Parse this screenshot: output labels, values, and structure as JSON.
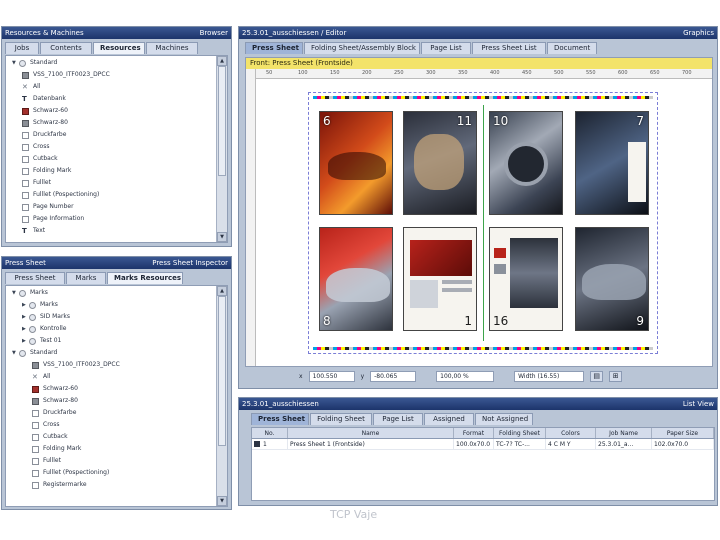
{
  "resources_panel": {
    "title": "Resources & Machines",
    "title_right": "Browser",
    "tabs": [
      "Jobs",
      "Contents",
      "Resources",
      "Machines"
    ],
    "active_tab": "Resources",
    "tree": [
      {
        "label": "Standard",
        "icon": "folder-icon",
        "expander": "minus"
      },
      {
        "label": "VSS_7100_ITF0023_DPCC",
        "icon": "color-swatch-icon"
      },
      {
        "label": "All",
        "icon": "cross-icon"
      },
      {
        "label": "Datenbank",
        "icon": "text-icon"
      },
      {
        "label": "Schwarz-60",
        "icon": "swatch-red-icon"
      },
      {
        "label": "Schwarz-80",
        "icon": "swatch-gray-icon"
      },
      {
        "label": "Druckfarbe",
        "icon": "page-icon"
      },
      {
        "label": "Cross",
        "icon": "page-icon"
      },
      {
        "label": "Cutback",
        "icon": "page-icon"
      },
      {
        "label": "Folding Mark",
        "icon": "page-icon"
      },
      {
        "label": "Fulllet",
        "icon": "page-icon"
      },
      {
        "label": "Fulllet (Pospectioning)",
        "icon": "page-icon"
      },
      {
        "label": "Page Number",
        "icon": "page-icon"
      },
      {
        "label": "Page Information",
        "icon": "page-icon"
      },
      {
        "label": "Text",
        "icon": "text-icon"
      }
    ]
  },
  "marks_panel": {
    "title": "Press Sheet",
    "title_right": "Press Sheet Inspector",
    "tabs": [
      "Press Sheet",
      "Marks",
      "Marks Resources"
    ],
    "active_tab": "Marks Resources",
    "tree": [
      {
        "label": "Marks",
        "icon": "folder-icon",
        "expander": "minus"
      },
      {
        "label": "Marks",
        "icon": "folder-icon",
        "expander": "plus",
        "indent": 1
      },
      {
        "label": "SID Marks",
        "icon": "folder-icon",
        "expander": "plus",
        "indent": 1
      },
      {
        "label": "Kontrolle",
        "icon": "folder-icon",
        "expander": "plus",
        "indent": 1
      },
      {
        "label": "Test 01",
        "icon": "folder-icon",
        "expander": "plus",
        "indent": 1
      },
      {
        "label": "Standard",
        "icon": "folder-icon",
        "expander": "minus"
      },
      {
        "label": "VSS_7100_ITF0023_DPCC",
        "icon": "color-swatch-icon",
        "indent": 1
      },
      {
        "label": "All",
        "icon": "cross-icon",
        "indent": 1
      },
      {
        "label": "Schwarz-60",
        "icon": "swatch-red-icon",
        "indent": 1
      },
      {
        "label": "Schwarz-80",
        "icon": "swatch-gray-icon",
        "indent": 1
      },
      {
        "label": "Druckfarbe",
        "icon": "page-icon",
        "indent": 1
      },
      {
        "label": "Cross",
        "icon": "page-icon",
        "indent": 1
      },
      {
        "label": "Cutback",
        "icon": "page-icon",
        "indent": 1
      },
      {
        "label": "Folding Mark",
        "icon": "page-icon",
        "indent": 1
      },
      {
        "label": "Fulllet",
        "icon": "page-icon",
        "indent": 1
      },
      {
        "label": "Fulllet (Pospectioning)",
        "icon": "page-icon",
        "indent": 1
      },
      {
        "label": "Registermarke",
        "icon": "page-icon",
        "indent": 1
      }
    ]
  },
  "editor_panel": {
    "title": "25.3.01_ausschiessen / Editor",
    "title_right": "Graphics",
    "tabs": [
      "Press Sheet",
      "Folding Sheet/Assembly Block",
      "Page List",
      "Press Sheet List",
      "Document"
    ],
    "active_tab": "Press Sheet",
    "sheet_label": "Front: Press Sheet    (Frontside)",
    "ruler_ticks": [
      "50",
      "100",
      "150",
      "200",
      "250",
      "300",
      "350",
      "400",
      "450",
      "500",
      "550",
      "600",
      "650",
      "700"
    ],
    "page_numbers": [
      "6",
      "11",
      "10",
      "7",
      "8",
      "1",
      "16",
      "9"
    ],
    "coords": {
      "x_label": "x",
      "x_value": "100.550",
      "y_label": "y",
      "y_value": "-80.065",
      "zoom": "100,00 %",
      "fit": "Width (16.55)"
    },
    "footer_icons": [
      "table-icon",
      "grid-icon"
    ]
  },
  "list_panel": {
    "title": "25.3.01_ausschiessen",
    "title_right": "List View",
    "tabs": [
      "Press Sheet",
      "Folding Sheet",
      "Page List",
      "Assigned",
      "Not Assigned"
    ],
    "active_tab": "Press Sheet",
    "columns": [
      "No.",
      "Name",
      "Format",
      "Folding Sheet",
      "Colors",
      "Job Name",
      "Paper Size"
    ],
    "rows": [
      [
        "1",
        "Press Sheet 1 (Frontside)",
        "100.0x70.0",
        "TC-7? TC-...",
        "4 C M Y",
        "25.3.01_a...",
        "102.0x70.0"
      ]
    ]
  },
  "footer": {
    "caption": "TCP   Vaje"
  },
  "colors": {
    "titlebar": "#1c346b",
    "panel_bg": "#b9c5d6",
    "sheet_header": "#f3e36a"
  }
}
